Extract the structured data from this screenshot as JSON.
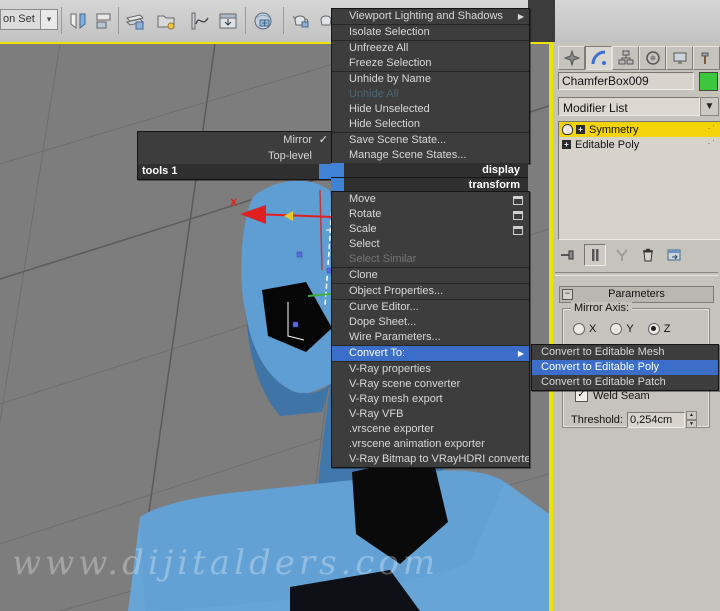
{
  "toolbar": {
    "selection_set_value": "on Set",
    "icons": [
      "mirror",
      "align",
      "layer-manager",
      "scene-explorer",
      "curve-editor",
      "schematic-view",
      "material-editor",
      "render-setup",
      "rendered-frame"
    ]
  },
  "quad_menu": {
    "tools_quad": {
      "title": "tools 1",
      "items": [
        {
          "label": "Mirror",
          "checked": true
        },
        {
          "label": "Top-level",
          "checked": false
        }
      ]
    },
    "display_quad": {
      "title": "display",
      "items": [
        {
          "label": "Viewport Lighting and Shadows",
          "submenu": true
        },
        {
          "label": "Isolate Selection"
        },
        {
          "label": "Unfreeze All"
        },
        {
          "label": "Freeze Selection"
        },
        {
          "label": "Unhide by Name"
        },
        {
          "label": "Unhide All",
          "disabled": true
        },
        {
          "label": "Hide Unselected"
        },
        {
          "label": "Hide Selection"
        },
        {
          "label": "Save Scene State..."
        },
        {
          "label": "Manage Scene States..."
        }
      ]
    },
    "transform_quad": {
      "title": "transform",
      "items": [
        {
          "label": "Move",
          "settings": true
        },
        {
          "label": "Rotate",
          "settings": true
        },
        {
          "label": "Scale",
          "settings": true
        },
        {
          "label": "Select"
        },
        {
          "label": "Select Similar",
          "disabled": true
        },
        {
          "label": "Clone"
        },
        {
          "label": "Object Properties..."
        },
        {
          "label": "Curve Editor..."
        },
        {
          "label": "Dope Sheet..."
        },
        {
          "label": "Wire Parameters..."
        },
        {
          "label": "Convert To:",
          "submenu": true,
          "highlighted": true
        },
        {
          "label": "V-Ray properties"
        },
        {
          "label": "V-Ray scene converter"
        },
        {
          "label": "V-Ray mesh export"
        },
        {
          "label": "V-Ray VFB"
        },
        {
          "label": ".vrscene exporter"
        },
        {
          "label": ".vrscene animation exporter"
        },
        {
          "label": "V-Ray Bitmap to VRayHDRI converter"
        }
      ]
    },
    "convert_submenu": {
      "items": [
        {
          "label": "Convert to Editable Mesh"
        },
        {
          "label": "Convert to Editable Poly",
          "highlighted": true
        },
        {
          "label": "Convert to Editable Patch"
        }
      ]
    }
  },
  "command_panel": {
    "tabs": [
      "create",
      "modify",
      "hierarchy",
      "motion",
      "display",
      "utilities"
    ],
    "active_tab": "modify",
    "object_name": "ChamferBox009",
    "object_color": "#3dc73d",
    "modifier_list_label": "Modifier List",
    "modifier_stack": [
      {
        "label": "Symmetry",
        "selected": true
      },
      {
        "label": "Editable Poly",
        "selected": false
      }
    ],
    "stack_buttons": [
      "pin-stack",
      "show-end-result",
      "make-unique",
      "remove-modifier",
      "configure-modifier-sets"
    ],
    "parameters": {
      "rollout_title": "Parameters",
      "mirror_axis_label": "Mirror Axis:",
      "axis_options": [
        {
          "label": "X",
          "selected": false
        },
        {
          "label": "Y",
          "selected": false
        },
        {
          "label": "Z",
          "selected": true
        }
      ],
      "weld_seam_label": "Weld Seam",
      "weld_seam_checked": true,
      "threshold_label": "Threshold:",
      "threshold_value": "0,254cm"
    }
  },
  "viewport": {
    "axis_gizmo_label": "X",
    "watermark": "www.dijitalders.com"
  },
  "colors": {
    "menu_bg": "#3d3d3d",
    "highlight_blue": "#3a6ec8",
    "selection_yellow": "#f5d40a",
    "viewport_border_yellow": "#ece300",
    "object_blue": "#5e9dd2"
  }
}
